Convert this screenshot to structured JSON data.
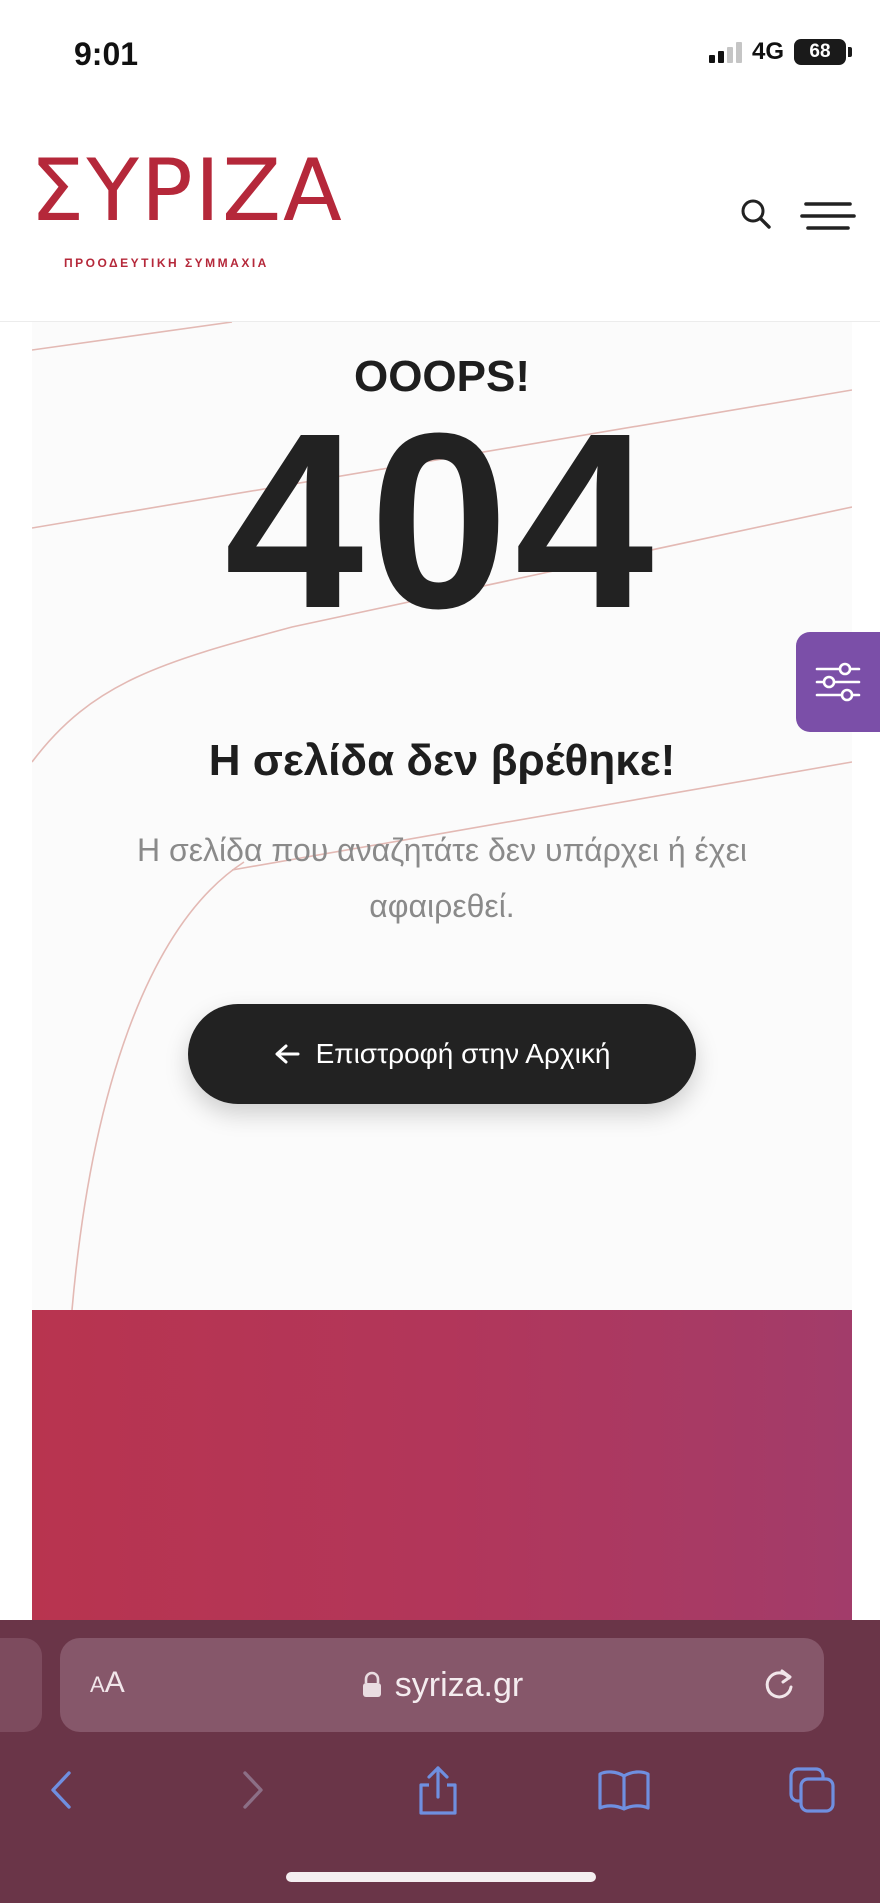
{
  "status_bar": {
    "time": "9:01",
    "network": "4G",
    "battery": "68"
  },
  "header": {
    "logo_text": "ΣΥΡΙΖΑ",
    "logo_subtitle": "ΠΡΟΟΔΕΥΤΙΚΗ ΣΥΜΜΑΧΙΑ",
    "search_icon": "search-icon",
    "menu_icon": "hamburger-menu-icon"
  },
  "error_page": {
    "ooops": "OOOPS!",
    "code": "404",
    "headline": "Η σελίδα δεν βρέθηκε!",
    "message": "Η σελίδα που αναζητάτε δεν υπάρχει ή έχει αφαιρεθεί.",
    "home_button_label": "Επιστροφή στην Αρχική",
    "home_button_icon": "arrow-left-icon"
  },
  "side_tab": {
    "icon": "sliders-icon"
  },
  "browser": {
    "aa_small": "A",
    "aa_big": "A",
    "url": "syriza.gr",
    "icons": [
      "lock-icon",
      "reload-icon",
      "back-icon",
      "forward-icon",
      "share-icon",
      "bookmarks-icon",
      "tabs-icon"
    ]
  },
  "colors": {
    "brand_red": "#b5283a",
    "dark": "#222222",
    "accent_purple": "#7b4fa8",
    "browser_bar": "#6a3548"
  }
}
